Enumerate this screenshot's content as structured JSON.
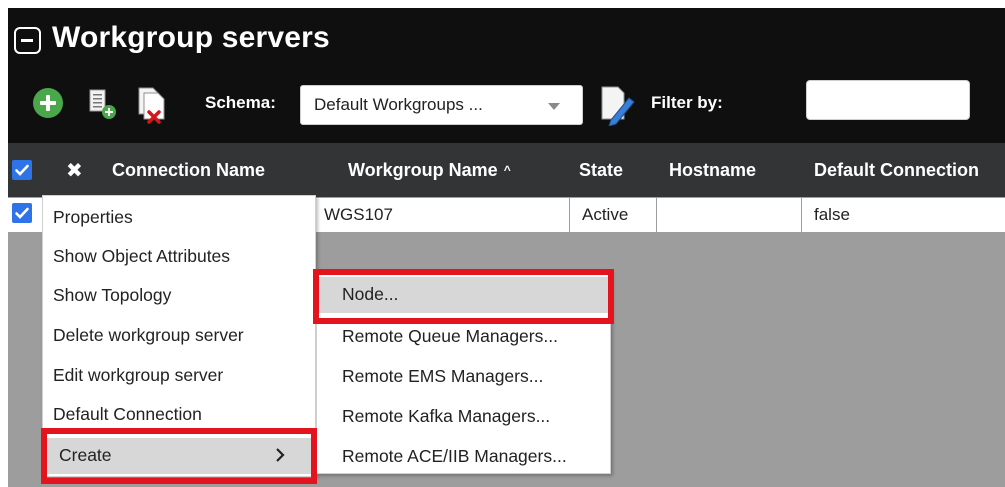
{
  "panel": {
    "title": "Workgroup servers",
    "collapse_icon": "minus-square-icon"
  },
  "toolbar": {
    "add_icon": "add-circle-icon",
    "add_server_icon": "add-server-icon",
    "delete_server_icon": "delete-server-icon",
    "schema_label": "Schema:",
    "schema_value": "Default Workgroups ...",
    "schema_icon": "edit-schema-icon",
    "filter_label": "Filter by:",
    "filter_value": ""
  },
  "table": {
    "columns": [
      "Connection Name",
      "Workgroup Name",
      "State",
      "Hostname",
      "Default Connection"
    ],
    "sort_indicator": "^",
    "select_all_checked": true,
    "clear_icon": "close-icon",
    "rows": [
      {
        "connection_name": "",
        "workgroup_name": "WGS107",
        "state": "Active",
        "hostname": "",
        "default_connection": "false",
        "checked": true
      }
    ]
  },
  "context_menu": {
    "items": [
      "Properties",
      "Show Object Attributes",
      "Show Topology",
      "Delete workgroup server",
      "Edit workgroup server",
      "Default Connection",
      "Create"
    ],
    "create_chevron": ">",
    "highlighted": "Create"
  },
  "create_submenu": {
    "items": [
      "Node...",
      "Remote Queue Managers...",
      "Remote EMS Managers...",
      "Remote Kafka Managers...",
      "Remote ACE/IIB Managers..."
    ],
    "highlighted": "Node..."
  },
  "colors": {
    "header_bg": "#0f0f0f",
    "column_header_bg": "#333436",
    "checkbox": "#2f73e8",
    "add_button": "#4aa84a",
    "highlight_border": "#e3141e",
    "grid_bg": "#9d9d9d",
    "menu_hover": "#d7d7d7"
  }
}
